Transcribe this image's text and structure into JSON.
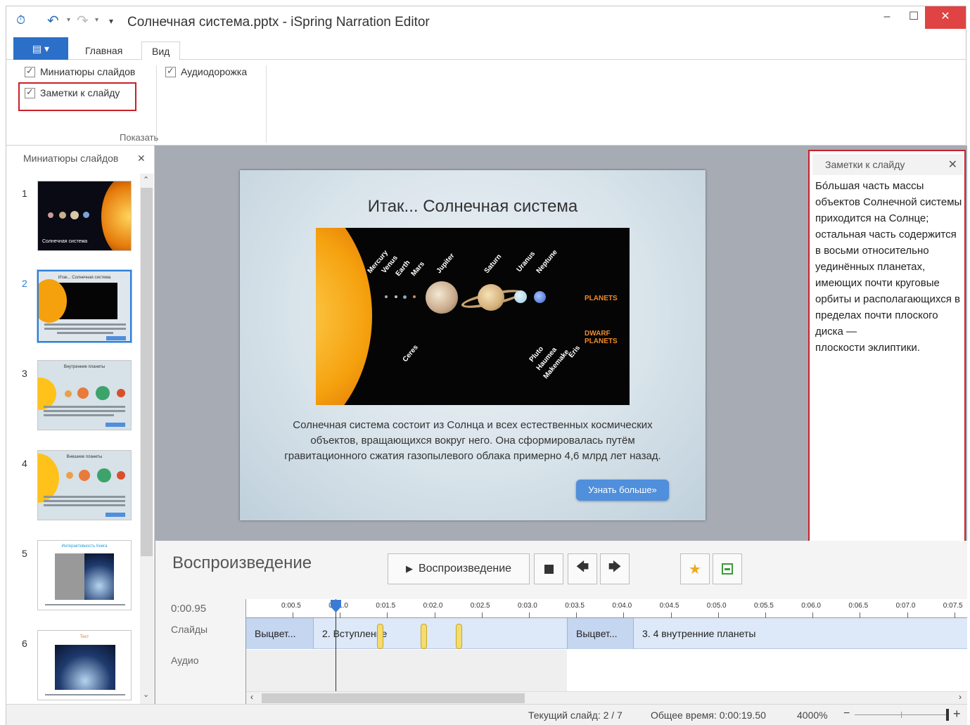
{
  "window": {
    "title": "Солнечная система.pptx - iSpring Narration Editor",
    "controls": {
      "minimize": "‒",
      "maximize": "☐",
      "close": "✕"
    }
  },
  "ribbon": {
    "file_tab": "▤ ▾",
    "tabs": [
      {
        "label": "Главная",
        "active": false
      },
      {
        "label": "Вид",
        "active": true
      }
    ],
    "checkboxes": {
      "slide_thumbnails": {
        "label": "Миниатюры слайдов",
        "checked": true
      },
      "audio_track": {
        "label": "Аудиодорожка",
        "checked": true
      },
      "slide_notes": {
        "label": "Заметки к слайду",
        "checked": true
      }
    },
    "group_label": "Показать"
  },
  "thumbnails_panel": {
    "title": "Миниатюры слайдов",
    "close": "✕",
    "items": [
      {
        "number": "1",
        "caption": "Солнечная система"
      },
      {
        "number": "2",
        "caption": "Итак... Солнечная система",
        "selected": true
      },
      {
        "number": "3",
        "caption": "Внутренние планеты"
      },
      {
        "number": "4",
        "caption": "Внешние планеты"
      },
      {
        "number": "5",
        "caption": "Интерактивность Книга"
      },
      {
        "number": "6",
        "caption": "Тест"
      }
    ]
  },
  "slide": {
    "title": "Итак... Солнечная система",
    "image_labels": {
      "planets": [
        "Mercury",
        "Venus",
        "Earth",
        "Mars",
        "Jupiter",
        "Saturn",
        "Uranus",
        "Neptune"
      ],
      "dwarf": [
        "Ceres",
        "Pluto",
        "Haumea",
        "Makemake",
        "Eris"
      ],
      "planets_tag": "PLANETS",
      "dwarf_tag_1": "DWARF",
      "dwarf_tag_2": "PLANETS"
    },
    "body": "Солнечная система состоит из Солнца и всех естественных космических объектов, вращающихся вокруг него. Она сформировалась путём гравитационного сжатия газопылевого облака примерно 4,6 млрд лет назад.",
    "button": "Узнать больше»"
  },
  "notes": {
    "title": "Заметки к слайду",
    "close": "✕",
    "text": "Бóльшая часть массы объектов Солнечной системы приходится на Солнце; остальная часть содержится в восьми относительно уединённых планетах, имеющих почти круговые орбиты и располагающихся в пределах почти плоского диска —\nплоскости эклиптики."
  },
  "playback": {
    "title": "Воспроизведение",
    "play_button": "Воспроизведение",
    "current_time": "0:00.95",
    "track_slides": "Слайды",
    "track_audio": "Аудио",
    "ruler": [
      "0:00.5",
      "0:01.0",
      "0:01.5",
      "0:02.0",
      "0:02.5",
      "0:03.0",
      "0:03.5",
      "0:04.0",
      "0:04.5",
      "0:05.0",
      "0:05.5",
      "0:06.0",
      "0:06.5",
      "0:07.0",
      "0:07.5"
    ],
    "segments": [
      {
        "label": "Выцвет...",
        "kind": "transition"
      },
      {
        "label": "2. Вступление",
        "kind": "slide"
      },
      {
        "label": "Выцвет...",
        "kind": "transition"
      },
      {
        "label": "3. 4 внутренние планеты",
        "kind": "slide"
      }
    ]
  },
  "status": {
    "current_slide": "Текущий слайд: 2 / 7",
    "total_time": "Общее время: 0:00:19.50",
    "zoom": "4000%"
  },
  "colors": {
    "accent": "#2b6fc9",
    "highlight": "#c8202a",
    "transition": "#c5d6f0",
    "marker": "#f4dc6e"
  }
}
